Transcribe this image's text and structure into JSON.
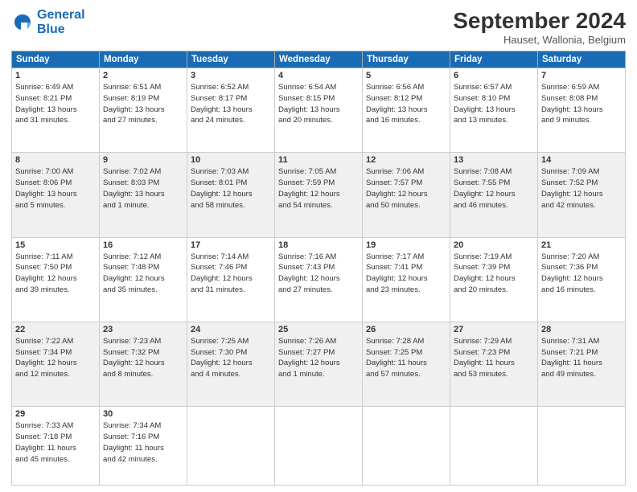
{
  "logo": {
    "line1": "General",
    "line2": "Blue"
  },
  "title": "September 2024",
  "location": "Hauset, Wallonia, Belgium",
  "headers": [
    "Sunday",
    "Monday",
    "Tuesday",
    "Wednesday",
    "Thursday",
    "Friday",
    "Saturday"
  ],
  "weeks": [
    [
      {
        "day": "1",
        "info": "Sunrise: 6:49 AM\nSunset: 8:21 PM\nDaylight: 13 hours\nand 31 minutes."
      },
      {
        "day": "2",
        "info": "Sunrise: 6:51 AM\nSunset: 8:19 PM\nDaylight: 13 hours\nand 27 minutes."
      },
      {
        "day": "3",
        "info": "Sunrise: 6:52 AM\nSunset: 8:17 PM\nDaylight: 13 hours\nand 24 minutes."
      },
      {
        "day": "4",
        "info": "Sunrise: 6:54 AM\nSunset: 8:15 PM\nDaylight: 13 hours\nand 20 minutes."
      },
      {
        "day": "5",
        "info": "Sunrise: 6:56 AM\nSunset: 8:12 PM\nDaylight: 13 hours\nand 16 minutes."
      },
      {
        "day": "6",
        "info": "Sunrise: 6:57 AM\nSunset: 8:10 PM\nDaylight: 13 hours\nand 13 minutes."
      },
      {
        "day": "7",
        "info": "Sunrise: 6:59 AM\nSunset: 8:08 PM\nDaylight: 13 hours\nand 9 minutes."
      }
    ],
    [
      {
        "day": "8",
        "info": "Sunrise: 7:00 AM\nSunset: 8:06 PM\nDaylight: 13 hours\nand 5 minutes."
      },
      {
        "day": "9",
        "info": "Sunrise: 7:02 AM\nSunset: 8:03 PM\nDaylight: 13 hours\nand 1 minute."
      },
      {
        "day": "10",
        "info": "Sunrise: 7:03 AM\nSunset: 8:01 PM\nDaylight: 12 hours\nand 58 minutes."
      },
      {
        "day": "11",
        "info": "Sunrise: 7:05 AM\nSunset: 7:59 PM\nDaylight: 12 hours\nand 54 minutes."
      },
      {
        "day": "12",
        "info": "Sunrise: 7:06 AM\nSunset: 7:57 PM\nDaylight: 12 hours\nand 50 minutes."
      },
      {
        "day": "13",
        "info": "Sunrise: 7:08 AM\nSunset: 7:55 PM\nDaylight: 12 hours\nand 46 minutes."
      },
      {
        "day": "14",
        "info": "Sunrise: 7:09 AM\nSunset: 7:52 PM\nDaylight: 12 hours\nand 42 minutes."
      }
    ],
    [
      {
        "day": "15",
        "info": "Sunrise: 7:11 AM\nSunset: 7:50 PM\nDaylight: 12 hours\nand 39 minutes."
      },
      {
        "day": "16",
        "info": "Sunrise: 7:12 AM\nSunset: 7:48 PM\nDaylight: 12 hours\nand 35 minutes."
      },
      {
        "day": "17",
        "info": "Sunrise: 7:14 AM\nSunset: 7:46 PM\nDaylight: 12 hours\nand 31 minutes."
      },
      {
        "day": "18",
        "info": "Sunrise: 7:16 AM\nSunset: 7:43 PM\nDaylight: 12 hours\nand 27 minutes."
      },
      {
        "day": "19",
        "info": "Sunrise: 7:17 AM\nSunset: 7:41 PM\nDaylight: 12 hours\nand 23 minutes."
      },
      {
        "day": "20",
        "info": "Sunrise: 7:19 AM\nSunset: 7:39 PM\nDaylight: 12 hours\nand 20 minutes."
      },
      {
        "day": "21",
        "info": "Sunrise: 7:20 AM\nSunset: 7:36 PM\nDaylight: 12 hours\nand 16 minutes."
      }
    ],
    [
      {
        "day": "22",
        "info": "Sunrise: 7:22 AM\nSunset: 7:34 PM\nDaylight: 12 hours\nand 12 minutes."
      },
      {
        "day": "23",
        "info": "Sunrise: 7:23 AM\nSunset: 7:32 PM\nDaylight: 12 hours\nand 8 minutes."
      },
      {
        "day": "24",
        "info": "Sunrise: 7:25 AM\nSunset: 7:30 PM\nDaylight: 12 hours\nand 4 minutes."
      },
      {
        "day": "25",
        "info": "Sunrise: 7:26 AM\nSunset: 7:27 PM\nDaylight: 12 hours\nand 1 minute."
      },
      {
        "day": "26",
        "info": "Sunrise: 7:28 AM\nSunset: 7:25 PM\nDaylight: 11 hours\nand 57 minutes."
      },
      {
        "day": "27",
        "info": "Sunrise: 7:29 AM\nSunset: 7:23 PM\nDaylight: 11 hours\nand 53 minutes."
      },
      {
        "day": "28",
        "info": "Sunrise: 7:31 AM\nSunset: 7:21 PM\nDaylight: 11 hours\nand 49 minutes."
      }
    ],
    [
      {
        "day": "29",
        "info": "Sunrise: 7:33 AM\nSunset: 7:18 PM\nDaylight: 11 hours\nand 45 minutes."
      },
      {
        "day": "30",
        "info": "Sunrise: 7:34 AM\nSunset: 7:16 PM\nDaylight: 11 hours\nand 42 minutes."
      },
      {
        "day": "",
        "info": ""
      },
      {
        "day": "",
        "info": ""
      },
      {
        "day": "",
        "info": ""
      },
      {
        "day": "",
        "info": ""
      },
      {
        "day": "",
        "info": ""
      }
    ]
  ]
}
